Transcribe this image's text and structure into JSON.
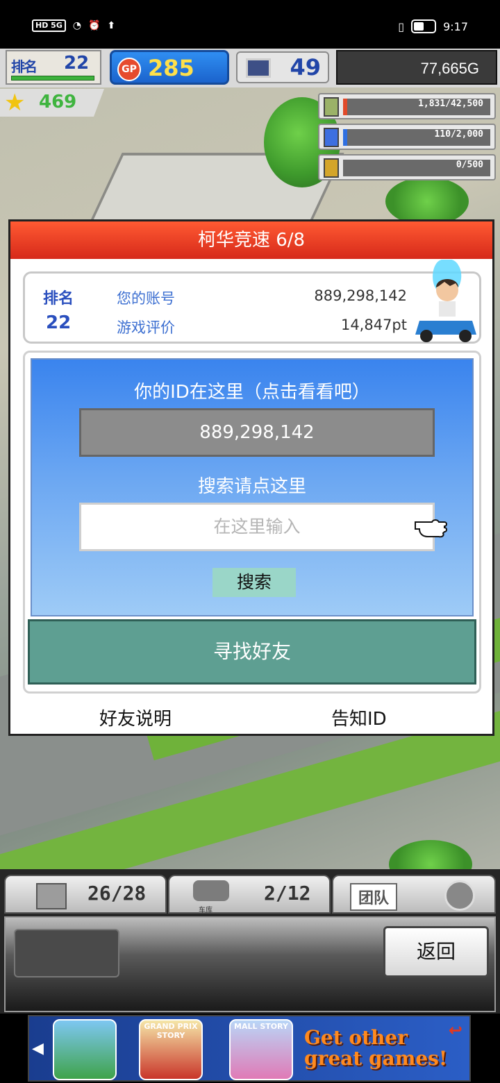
{
  "status_bar": {
    "left_indicators": "HD 5G",
    "time": "9:17"
  },
  "hud": {
    "rank_label": "排名",
    "rank_value": "22",
    "gp_label": "GP",
    "gp_value": "285",
    "pc_value": "49",
    "money": "77,665G",
    "stars": "469"
  },
  "resources": [
    {
      "icon": "money-bag-icon",
      "value": "1,831/42,500",
      "color": "#e04a2a"
    },
    {
      "icon": "fuel-icon",
      "value": "110/2,000",
      "color": "#2f6fe0"
    },
    {
      "icon": "wheat-icon",
      "value": "0/500",
      "color": "#c9c9c9"
    }
  ],
  "dialog": {
    "title": "柯华竞速 6/8",
    "profile": {
      "rank_label": "排名",
      "rank_value": "22",
      "account_label": "您的账号",
      "account_value": "889,298,142",
      "rating_label": "游戏评价",
      "rating_value": "14,847pt"
    },
    "id_prompt": "你的ID在这里（点击看看吧）",
    "id_value": "889,298,142",
    "search_prompt": "搜索请点这里",
    "search_placeholder": "在这里输入",
    "search_button": "搜索",
    "find_friends_button": "寻找好友",
    "friend_help_link": "好友说明",
    "tell_id_link": "告知ID"
  },
  "bottom_bar": {
    "slot1": {
      "value": "26/28"
    },
    "slot2": {
      "value": "2/12",
      "sub_label": "车库"
    },
    "slot3": {
      "label": "团队"
    },
    "back_button": "返回"
  },
  "ad": {
    "game2_title": "GRAND PRIX STORY",
    "game3_title": "MALL STORY",
    "text": "Get other great games!"
  },
  "colors": {
    "title_red": "#e2381f",
    "panel_blue": "#3a84ee",
    "find_teal": "#5e9f92"
  }
}
